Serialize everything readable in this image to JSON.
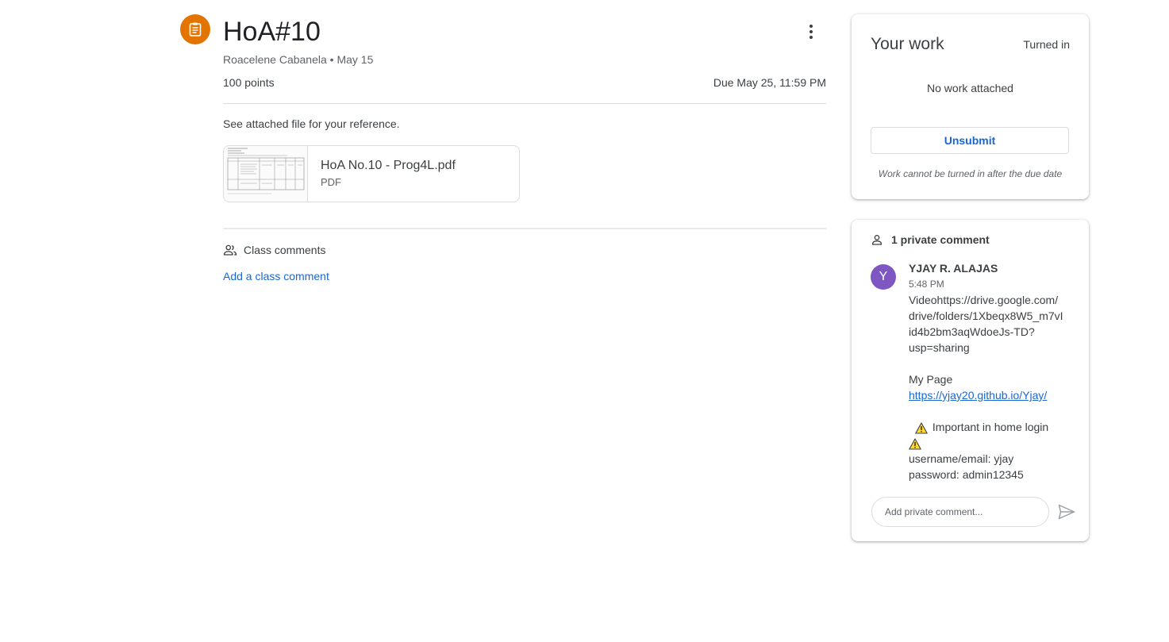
{
  "assignment": {
    "title": "HoA#10",
    "author": "Roacelene Cabanela",
    "posted": "May 15",
    "meta_sep": "•",
    "points": "100 points",
    "due": "Due May 25, 11:59 PM",
    "description": "See attached file for your reference.",
    "attachment": {
      "name": "HoA No.10 - Prog4L.pdf",
      "type": "PDF"
    }
  },
  "class_comments": {
    "label": "Class comments",
    "add_link": "Add a class comment"
  },
  "your_work": {
    "title": "Your work",
    "status": "Turned in",
    "empty_text": "No work attached",
    "unsubmit_label": "Unsubmit",
    "note": "Work cannot be turned in after the due date"
  },
  "private_comments": {
    "label": "1 private comment",
    "comment": {
      "avatar_initial": "Y",
      "author": "YJAY R. ALAJAS",
      "time": "5:48 PM",
      "lines": [
        "Videohttps://drive.google.com/",
        "drive/folders/1Xbeqx8W5_m7vI",
        "id4b2bm3aqWdoeJs-TD?",
        "usp=sharing"
      ],
      "page_label": "My Page",
      "page_link": "https://yjay20.github.io/Yjay/",
      "important": "Important  in home login",
      "username": "username/email: yjay",
      "password": "password: admin12345"
    },
    "input_placeholder": "Add private comment..."
  },
  "colors": {
    "assignment_icon": "#e37400",
    "link": "#1967d2",
    "avatar": "#7e57c2"
  },
  "icons": [
    "assignment-icon",
    "more-vert-icon",
    "people-icon",
    "person-icon",
    "warning-icon",
    "send-icon"
  ]
}
